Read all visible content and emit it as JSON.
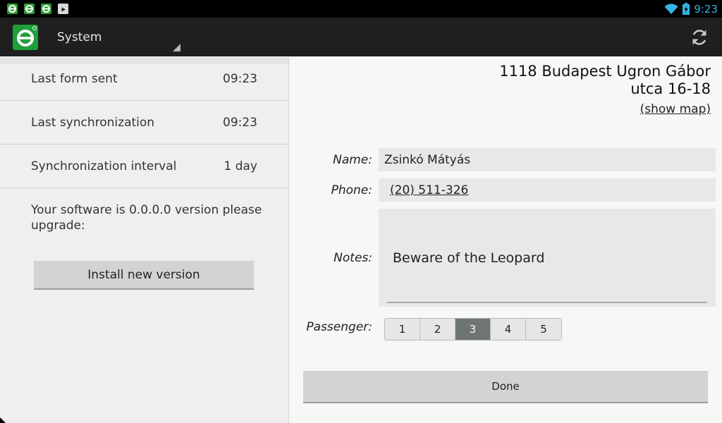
{
  "status_bar": {
    "time": "9:23",
    "notification_icons": [
      "app-icon",
      "app-icon",
      "app-icon",
      "play-store-icon"
    ],
    "system_icons": [
      "wifi-icon",
      "battery-charging-icon"
    ]
  },
  "action_bar": {
    "title": "System",
    "app_icon": "app-logo-icon",
    "refresh_icon": "sync-icon",
    "accent_color": "#1f9f3a"
  },
  "left_panel": {
    "rows": [
      {
        "label": "Last form sent",
        "value": "09:23"
      },
      {
        "label": "Last synchronization",
        "value": "09:23"
      },
      {
        "label": "Synchronization interval",
        "value": "1 day"
      }
    ],
    "upgrade_message": "Your software is 0.0.0.0 version please upgrade:",
    "install_button": "Install new version"
  },
  "right_panel": {
    "address_line1": "1118 Budapest Ugron Gábor",
    "address_line2": "utca 16-18",
    "show_map": "(show map)",
    "name_label": "Name:",
    "name_value": "Zsinkó Mátyás",
    "phone_label": "Phone:",
    "phone_value": "(20) 511-326",
    "notes_label": "Notes:",
    "notes_value": "Beware of the Leopard",
    "passenger_label": "Passenger:",
    "passenger_options": [
      "1",
      "2",
      "3",
      "4",
      "5"
    ],
    "passenger_selected": "3",
    "done_button": "Done"
  }
}
